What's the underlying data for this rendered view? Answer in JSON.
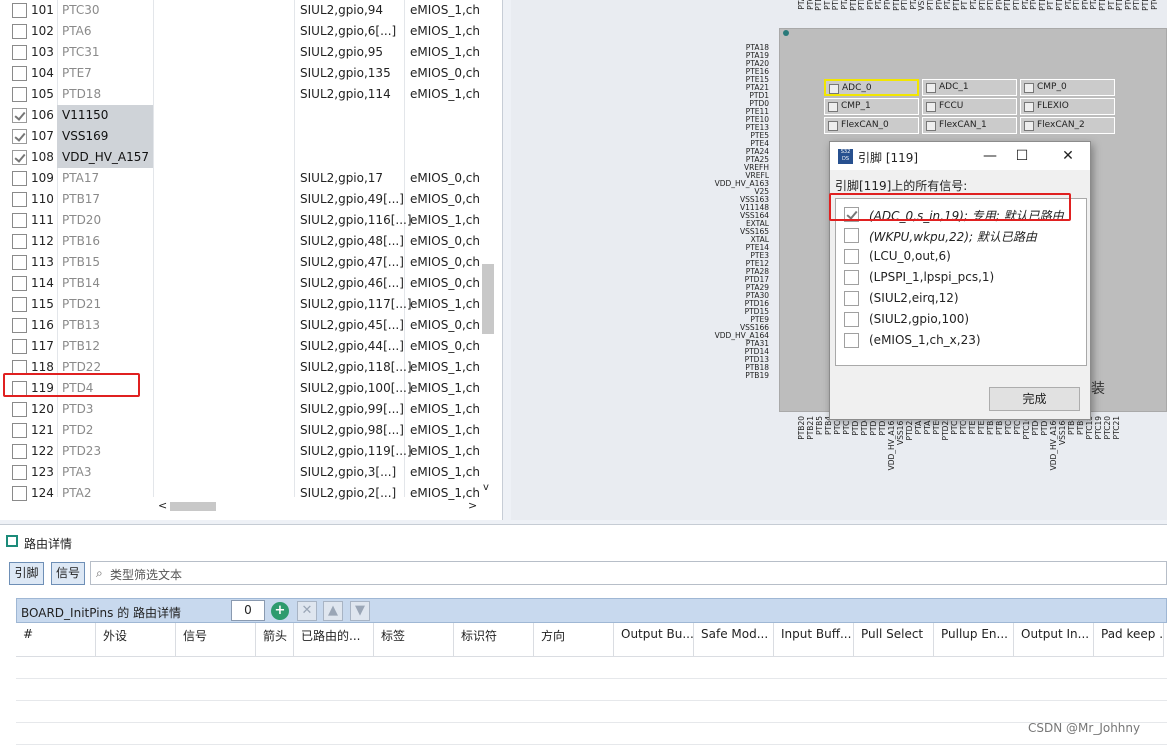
{
  "pin_table": {
    "rows": [
      {
        "num": "101",
        "name": "PTC30",
        "c1": "SIUL2,gpio,94",
        "c2": "eMIOS_1,ch",
        "checked": false,
        "shaded": false
      },
      {
        "num": "102",
        "name": "PTA6",
        "c1": "SIUL2,gpio,6[...]",
        "c2": "eMIOS_1,ch",
        "checked": false,
        "shaded": false
      },
      {
        "num": "103",
        "name": "PTC31",
        "c1": "SIUL2,gpio,95",
        "c2": "eMIOS_1,ch",
        "checked": false,
        "shaded": false
      },
      {
        "num": "104",
        "name": "PTE7",
        "c1": "SIUL2,gpio,135",
        "c2": "eMIOS_0,ch",
        "checked": false,
        "shaded": false
      },
      {
        "num": "105",
        "name": "PTD18",
        "c1": "SIUL2,gpio,114",
        "c2": "eMIOS_1,ch",
        "checked": false,
        "shaded": false
      },
      {
        "num": "106",
        "name": "V11150",
        "c1": "",
        "c2": "",
        "checked": true,
        "shaded": true
      },
      {
        "num": "107",
        "name": "VSS169",
        "c1": "",
        "c2": "",
        "checked": true,
        "shaded": true
      },
      {
        "num": "108",
        "name": "VDD_HV_A157",
        "c1": "",
        "c2": "",
        "checked": true,
        "shaded": true
      },
      {
        "num": "109",
        "name": "PTA17",
        "c1": "SIUL2,gpio,17",
        "c2": "eMIOS_0,ch",
        "checked": false,
        "shaded": false
      },
      {
        "num": "110",
        "name": "PTB17",
        "c1": "SIUL2,gpio,49[...]",
        "c2": "eMIOS_0,ch",
        "checked": false,
        "shaded": false
      },
      {
        "num": "111",
        "name": "PTD20",
        "c1": "SIUL2,gpio,116[...]",
        "c2": "eMIOS_1,ch",
        "checked": false,
        "shaded": false
      },
      {
        "num": "112",
        "name": "PTB16",
        "c1": "SIUL2,gpio,48[...]",
        "c2": "eMIOS_0,ch",
        "checked": false,
        "shaded": false
      },
      {
        "num": "113",
        "name": "PTB15",
        "c1": "SIUL2,gpio,47[...]",
        "c2": "eMIOS_0,ch",
        "checked": false,
        "shaded": false
      },
      {
        "num": "114",
        "name": "PTB14",
        "c1": "SIUL2,gpio,46[...]",
        "c2": "eMIOS_0,ch",
        "checked": false,
        "shaded": false
      },
      {
        "num": "115",
        "name": "PTD21",
        "c1": "SIUL2,gpio,117[...]",
        "c2": "eMIOS_1,ch",
        "checked": false,
        "shaded": false
      },
      {
        "num": "116",
        "name": "PTB13",
        "c1": "SIUL2,gpio,45[...]",
        "c2": "eMIOS_0,ch",
        "checked": false,
        "shaded": false
      },
      {
        "num": "117",
        "name": "PTB12",
        "c1": "SIUL2,gpio,44[...]",
        "c2": "eMIOS_0,ch",
        "checked": false,
        "shaded": false
      },
      {
        "num": "118",
        "name": "PTD22",
        "c1": "SIUL2,gpio,118[...]",
        "c2": "eMIOS_1,ch",
        "checked": false,
        "shaded": false
      },
      {
        "num": "119",
        "name": "PTD4",
        "c1": "SIUL2,gpio,100[...]",
        "c2": "eMIOS_1,ch",
        "checked": false,
        "shaded": false
      },
      {
        "num": "120",
        "name": "PTD3",
        "c1": "SIUL2,gpio,99[...]",
        "c2": "eMIOS_1,ch",
        "checked": false,
        "shaded": false
      },
      {
        "num": "121",
        "name": "PTD2",
        "c1": "SIUL2,gpio,98[...]",
        "c2": "eMIOS_1,ch",
        "checked": false,
        "shaded": false
      },
      {
        "num": "122",
        "name": "PTD23",
        "c1": "SIUL2,gpio,119[...]",
        "c2": "eMIOS_1,ch",
        "checked": false,
        "shaded": false
      },
      {
        "num": "123",
        "name": "PTA3",
        "c1": "SIUL2,gpio,3[...]",
        "c2": "eMIOS_1,ch",
        "checked": false,
        "shaded": false
      },
      {
        "num": "124",
        "name": "PTA2",
        "c1": "SIUL2,gpio,2[...]",
        "c2": "eMIOS_1,ch",
        "checked": false,
        "shaded": false
      }
    ],
    "scroll_left_arrow": "<",
    "scroll_right_arrow": ">",
    "scroll_down_arrow": "v"
  },
  "chip": {
    "peripherals": [
      {
        "label": "ADC_0",
        "hl": true
      },
      {
        "label": "ADC_1",
        "hl": false
      },
      {
        "label": "CMP_0",
        "hl": false
      },
      {
        "label": "CMP_1",
        "hl": false
      },
      {
        "label": "FCCU",
        "hl": false
      },
      {
        "label": "FLEXIO",
        "hl": false
      },
      {
        "label": "FlexCAN_0",
        "hl": false
      },
      {
        "label": "FlexCAN_1",
        "hl": false
      },
      {
        "label": "FlexCAN_2",
        "hl": false
      }
    ],
    "left_pins": [
      "PTA18",
      "PTA19",
      "PTA20",
      "PTE16",
      "PTE15",
      "PTA21",
      "PTD1",
      "PTD0",
      "PTE11",
      "PTE10",
      "PTE13",
      "PTE5",
      "PTE4",
      "PTA24",
      "PTA25",
      "VREFH",
      "VREFL",
      "VDD_HV_A163",
      "V25",
      "VSS163",
      "V11148",
      "VSS164",
      "EXTAL",
      "VSS165",
      "XTAL",
      "PTE14",
      "PTE3",
      "PTE12",
      "PTA28",
      "PTD17",
      "PTA29",
      "PTA30",
      "PTD16",
      "PTD15",
      "PTE9",
      "VSS166",
      "VDD_HV_A164",
      "PTA31",
      "PTD14",
      "PTD13",
      "PTB18",
      "PTB19"
    ],
    "bottom_pins": [
      "PTB20",
      "PTB21",
      "PTB5",
      "PTB4",
      "PTC6",
      "PTC7",
      "PTD5",
      "PTD4",
      "PTD3",
      "PTD2",
      "VDD_HV_A165",
      "VSS167",
      "PTD23",
      "PTA3",
      "PTA2",
      "PTE0",
      "PTD22",
      "PTC1",
      "PTC0",
      "PTE1",
      "PTE2",
      "PTB2",
      "PTB3",
      "PTC8",
      "PTC9",
      "PTC10",
      "PTD6",
      "PTD7",
      "VDD_HV_A166",
      "VSS168",
      "PTB8",
      "PTB9",
      "PTC18",
      "PTC19",
      "PTC20",
      "PTC21"
    ],
    "top_pins": [
      "PTA",
      "PTC",
      "PTD",
      "PTE",
      "PTB",
      "PTA",
      "PTD",
      "PTB",
      "PTC",
      "PTA",
      "PTC",
      "PTD",
      "PTB",
      "PTA",
      "VSS",
      "PTB",
      "PTC",
      "PTA",
      "PTD",
      "PTE",
      "PTA",
      "PTB",
      "PTB",
      "PTC",
      "PTD",
      "PTB",
      "PTA",
      "PTC",
      "PTD",
      "PTE",
      "PTD",
      "PTA",
      "PTB",
      "PTC",
      "PTA",
      "PTD",
      "PTE",
      "PTD",
      "PTC",
      "PTB",
      "PTD",
      "PTC"
    ],
    "side_text": "装"
  },
  "dialog": {
    "title": "引脚 [119]",
    "subtitle": "引脚[119]上的所有信号:",
    "signals": [
      {
        "text": "(ADC_0,s_in,19); 专用; 默认已路由",
        "checked": true,
        "italic": true
      },
      {
        "text": "(WKPU,wkpu,22); 默认已路由",
        "checked": false,
        "italic": true
      },
      {
        "text": "(LCU_0,out,6)",
        "checked": false,
        "italic": false
      },
      {
        "text": "(LPSPI_1,lpspi_pcs,1)",
        "checked": false,
        "italic": false
      },
      {
        "text": "(SIUL2,eirq,12)",
        "checked": false,
        "italic": false
      },
      {
        "text": "(SIUL2,gpio,100)",
        "checked": false,
        "italic": false
      },
      {
        "text": "(eMIOS_1,ch_x,23)",
        "checked": false,
        "italic": false
      }
    ],
    "done_label": "完成",
    "app_icon_text": "S32 DS",
    "minimize": "—",
    "maximize": "☐",
    "close": "✕"
  },
  "routing": {
    "tab_label": "路由详情",
    "toggle_pin": "引脚",
    "toggle_signal": "信号",
    "filter_placeholder": "类型筛选文本",
    "grid_title": "BOARD_InitPins 的 路由详情",
    "count": "0",
    "add_label": "+",
    "delete_label": "✕",
    "up_label": "▲",
    "down_label": "▼",
    "columns": [
      "#",
      "外设",
      "信号",
      "箭头",
      "已路由的...",
      "标签",
      "标识符",
      "方向",
      "Output Bu...",
      "Safe Mod...",
      "Input Buff...",
      "Pull Select",
      "Pullup En...",
      "Output In...",
      "Pad keep ..."
    ]
  },
  "watermark": "CSDN @Mr_Johhny",
  "colors": {
    "selection_red": "#e02020",
    "highlight_yellow": "#f2e600",
    "header_blue": "#c8d9ee"
  }
}
